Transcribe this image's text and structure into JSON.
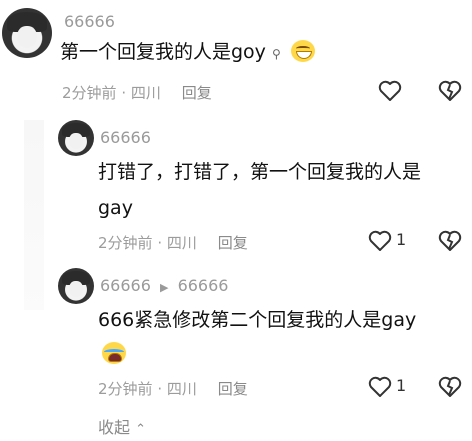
{
  "comments": [
    {
      "user": "66666",
      "text": "第一个回复我的人是goy",
      "time": "2分钟前",
      "location": "四川",
      "reply_label": "回复"
    },
    {
      "user": "66666",
      "text_line1": "打错了，打错了，第一个回复我的人是",
      "text_line2": "gay",
      "time": "2分钟前",
      "location": "四川",
      "reply_label": "回复",
      "likes": "1"
    },
    {
      "user": "66666",
      "reply_to": "66666",
      "text": "666紧急修改第二个回复我的人是gay",
      "time": "2分钟前",
      "location": "四川",
      "reply_label": "回复",
      "likes": "1"
    }
  ],
  "collapse_label": "收起",
  "icons": {
    "like": "heart-outline-icon",
    "dislike": "broken-heart-icon",
    "emoji_laugh": "laughing-emoji-icon",
    "emoji_cry": "crying-emoji-icon",
    "search_hint": "search-icon",
    "reply_arrow": "triangle-right-icon",
    "collapse_arrow": "chevron-up-icon"
  }
}
